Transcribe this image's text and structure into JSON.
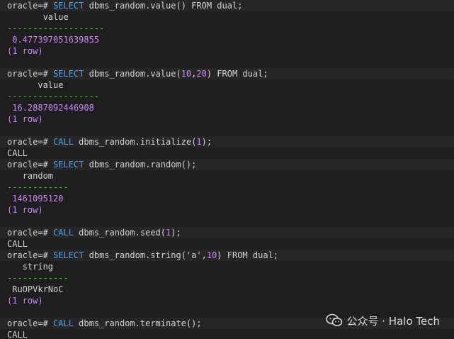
{
  "prompt": "oracle=#",
  "commands": {
    "c1": {
      "kw": "SELECT",
      "func": "dbms_random.value",
      "args_open": "(",
      "args": "",
      "args_close": ")",
      "tail_kw": "FROM",
      "table": "dual",
      "semi": ";"
    },
    "c2": {
      "kw": "SELECT",
      "func": "dbms_random.value",
      "args_open": "(",
      "arg1": "10",
      "comma": ",",
      "arg2": "20",
      "args_close": ")",
      "tail_kw": "FROM",
      "table": "dual",
      "semi": ";"
    },
    "c3": {
      "kw": "CALL",
      "func": "dbms_random.initialize",
      "args_open": "(",
      "arg1": "1",
      "args_close": ")",
      "semi": ";"
    },
    "c4": {
      "kw": "SELECT",
      "func": "dbms_random.random",
      "args_open": "(",
      "args_close": ")",
      "semi": ";"
    },
    "c5": {
      "kw": "CALL",
      "func": "dbms_random.seed",
      "args_open": "(",
      "arg1": "1",
      "args_close": ")",
      "semi": ";"
    },
    "c6": {
      "kw": "SELECT",
      "func": "dbms_random.string",
      "args_open": "(",
      "arg1": "'a'",
      "comma": ",",
      "arg2": "10",
      "args_close": ")",
      "tail_kw": "FROM",
      "table": "dual",
      "semi": ";"
    },
    "c7": {
      "kw": "CALL",
      "func": "dbms_random.terminate",
      "args_open": "(",
      "args_close": ")",
      "semi": ";"
    }
  },
  "results": {
    "r1": {
      "header": "value",
      "separator": "-------------------",
      "value": "0.477397051639855",
      "rows": "(1 row)"
    },
    "r2": {
      "header": "value",
      "separator": "------------------",
      "value": "16.2887092446908",
      "rows": "(1 row)"
    },
    "r3": {
      "call": "CALL"
    },
    "r4": {
      "header": "random",
      "separator": "------------",
      "value": "1461095120",
      "rows": "(1 row)"
    },
    "r5": {
      "call": "CALL"
    },
    "r6": {
      "header": "string",
      "separator": "------------",
      "value": "RuOPVkrNoC",
      "rows": "(1 row)"
    },
    "r7": {
      "call": "CALL"
    }
  },
  "watermark": {
    "text": "公众号 · Halo Tech",
    "icon": "wechat-icon"
  },
  "colors": {
    "background": "#1e1e1e",
    "command_line_bg": "#262626",
    "keyword": "#4fa6e6",
    "number": "#c58af9",
    "separator": "#4ec94e",
    "text": "#d4d4d4"
  }
}
